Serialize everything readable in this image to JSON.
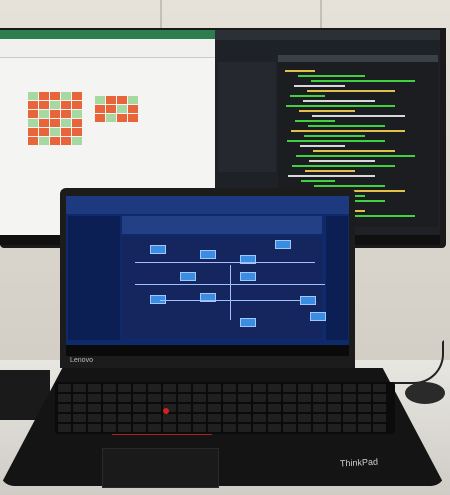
{
  "laptop": {
    "brand_label": "Lenovo",
    "logo_label": "ThinkPad"
  },
  "colors": {
    "excel_accent": "#2e7d4f",
    "cell_orange": "#e8643a",
    "cell_green": "#a7d8a2",
    "laptop_screen_blue": "#0f2a6b",
    "trackpoint_red": "#d62020"
  }
}
